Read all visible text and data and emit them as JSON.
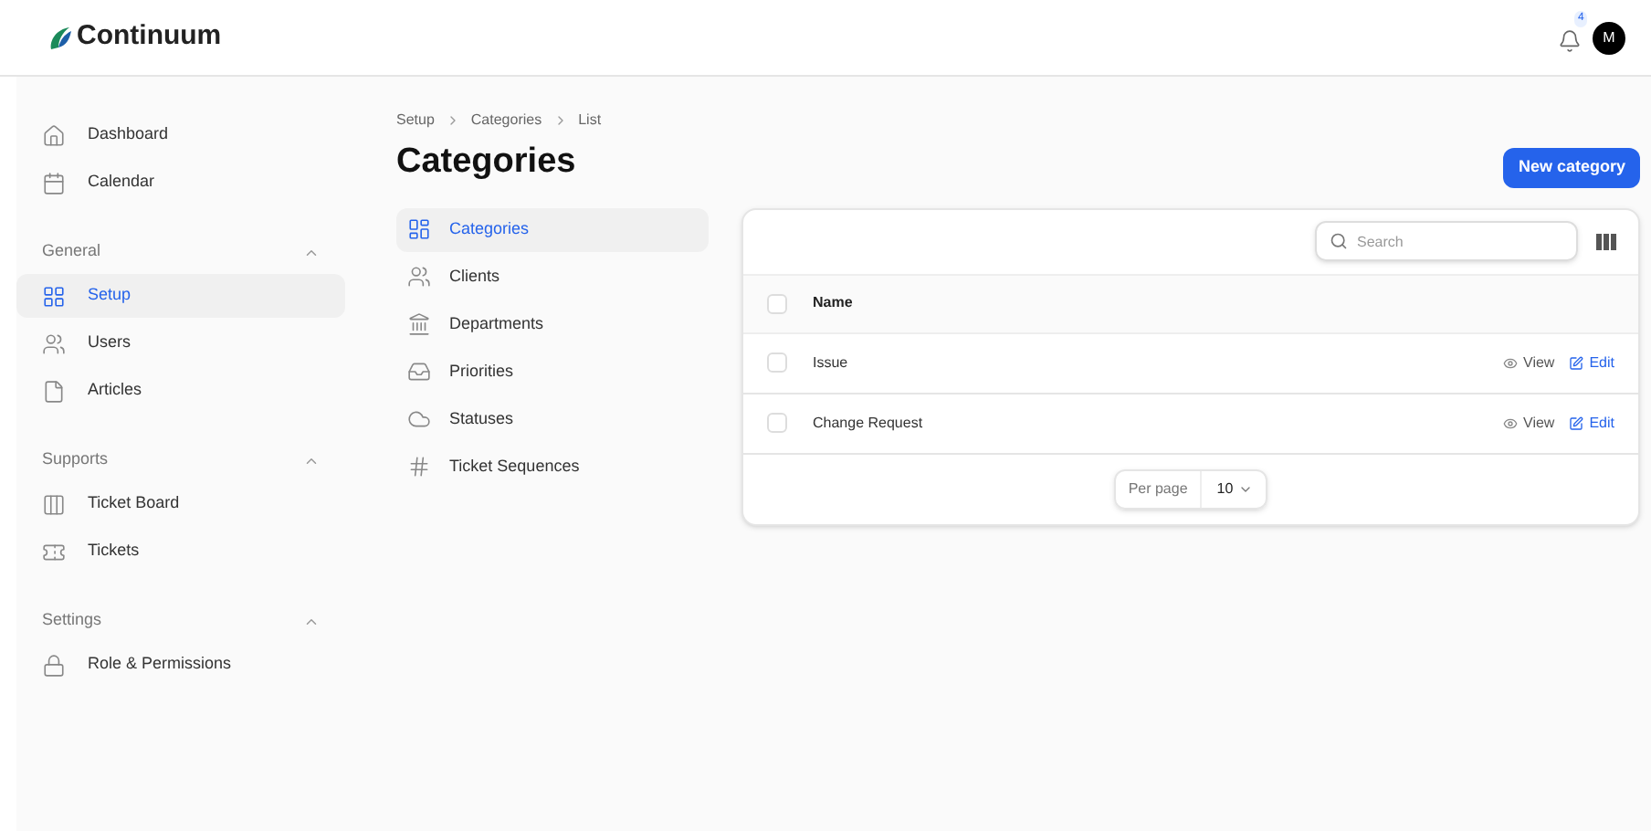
{
  "header": {
    "logo": "Continuum",
    "notifications": {
      "count": "4"
    },
    "avatar": "M"
  },
  "sidebar": {
    "items": [
      {
        "label": "Dashboard",
        "selected": false
      },
      {
        "label": "Calendar",
        "selected": false
      }
    ],
    "sections": [
      {
        "title": "General",
        "expanded": true,
        "items": [
          {
            "label": "Setup",
            "selected": true
          },
          {
            "label": "Users",
            "selected": false
          },
          {
            "label": "Articles",
            "selected": false
          }
        ]
      },
      {
        "title": "Supports",
        "expanded": true,
        "items": [
          {
            "label": "Ticket Board",
            "selected": false
          },
          {
            "label": "Tickets",
            "selected": false
          }
        ]
      },
      {
        "title": "Settings",
        "expanded": true,
        "items": [
          {
            "label": "Role & Permissions",
            "selected": false
          }
        ]
      }
    ]
  },
  "breadcrumb": [
    "Setup",
    "Categories",
    "List"
  ],
  "title": "Categories",
  "new_button": "New category",
  "subnav": [
    {
      "label": "Categories",
      "selected": true
    },
    {
      "label": "Clients",
      "selected": false
    },
    {
      "label": "Departments",
      "selected": false
    },
    {
      "label": "Priorities",
      "selected": false
    },
    {
      "label": "Statuses",
      "selected": false
    },
    {
      "label": "Ticket Sequences",
      "selected": false
    }
  ],
  "table": {
    "search": {
      "placeholder": "Search"
    },
    "all_checked": false,
    "columns": [
      "Name"
    ],
    "rows": [
      {
        "name": "Issue",
        "checked": false,
        "actions": [
          "View",
          "Edit"
        ]
      },
      {
        "name": "Change Request",
        "checked": false,
        "actions": [
          "View",
          "Edit"
        ]
      }
    ],
    "pagination": {
      "label": "Per page",
      "value": "10"
    }
  }
}
